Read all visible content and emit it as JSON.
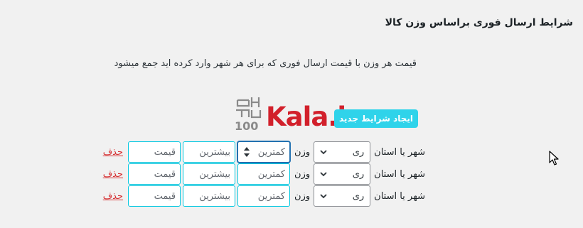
{
  "page": {
    "title": "شرایط ارسال فوری براساس وزن کالا",
    "description": "قیمت هر وزن با قیمت ارسال فوری که برای هر شهر وارد کرده اید جمع میشود"
  },
  "logo": {
    "text": "Kala.ir",
    "mark_text": "100"
  },
  "add_button": {
    "label": "ایجاد شرایط جدید"
  },
  "rows": [
    {
      "city_label": "شهر یا استان",
      "city_value": "ری",
      "weight_label": "وزن",
      "min_placeholder": "کمترین",
      "max_placeholder": "بیشترین",
      "price_placeholder": "قیمت",
      "delete_label": "حذف"
    },
    {
      "city_label": "شهر یا استان",
      "city_value": "ری",
      "weight_label": "وزن",
      "min_placeholder": "کمترین",
      "max_placeholder": "بیشترین",
      "price_placeholder": "قیمت",
      "delete_label": "حذف"
    },
    {
      "city_label": "شهر یا استان",
      "city_value": "ری",
      "weight_label": "وزن",
      "min_placeholder": "کمترین",
      "max_placeholder": "بیشترین",
      "price_placeholder": "قیمت",
      "delete_label": "حذف"
    }
  ],
  "colors": {
    "accent": "#2fd3ea",
    "delete": "#d63638",
    "logo": "#d2202b"
  }
}
